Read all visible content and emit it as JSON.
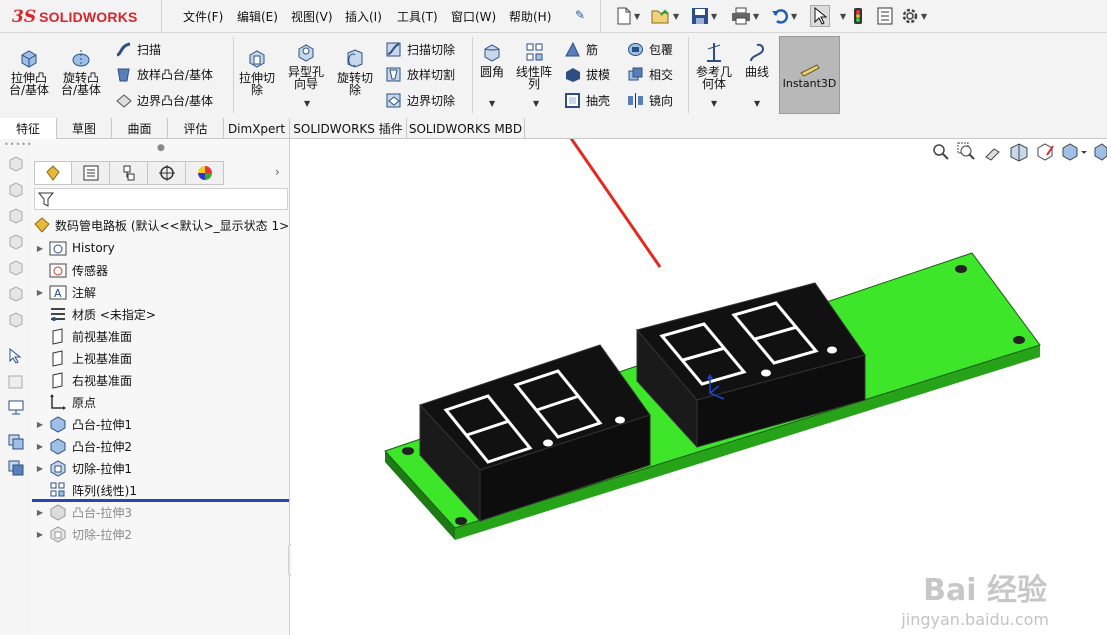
{
  "app": {
    "brand_prefix": "3S",
    "brand_name": "SOLIDWORKS"
  },
  "menu": [
    {
      "label": "文件(F)"
    },
    {
      "label": "编辑(E)"
    },
    {
      "label": "视图(V)"
    },
    {
      "label": "插入(I)"
    },
    {
      "label": "工具(T)"
    },
    {
      "label": "窗口(W)"
    },
    {
      "label": "帮助(H)"
    }
  ],
  "ribbon": {
    "extrude_boss": "拉伸凸\n台/基体",
    "revolve_boss": "旋转凸\n台/基体",
    "sweep": "扫描",
    "loft_boss": "放样凸台/基体",
    "boundary_boss": "边界凸台/基体",
    "extrude_cut": "拉伸切\n除",
    "hole_wizard": "异型孔\n向导",
    "revolve_cut": "旋转切\n除",
    "swept_cut": "扫描切除",
    "lofted_cut": "放样切割",
    "boundary_cut": "边界切除",
    "fillet": "圆角",
    "linear_pattern": "线性阵\n列",
    "rib": "筋",
    "draft": "拔模",
    "shell": "抽壳",
    "wrap": "包覆",
    "intersect": "相交",
    "mirror": "镜向",
    "ref_geometry": "参考几\n何体",
    "curves": "曲线",
    "instant3d": "Instant3D"
  },
  "tabs": [
    {
      "label": "特征",
      "active": true
    },
    {
      "label": "草图"
    },
    {
      "label": "曲面"
    },
    {
      "label": "评估"
    },
    {
      "label": "DimXpert"
    },
    {
      "label": "SOLIDWORKS 插件"
    },
    {
      "label": "SOLIDWORKS MBD"
    }
  ],
  "tree": {
    "root": "数码管电路板 (默认<<默认>_显示状态 1>",
    "items": [
      {
        "label": "History",
        "expandable": true
      },
      {
        "label": "传感器",
        "expandable": false
      },
      {
        "label": "注解",
        "expandable": true
      },
      {
        "label": "材质 <未指定>",
        "expandable": false
      },
      {
        "label": "前视基准面",
        "expandable": false
      },
      {
        "label": "上视基准面",
        "expandable": false
      },
      {
        "label": "右视基准面",
        "expandable": false
      },
      {
        "label": "原点",
        "expandable": false
      },
      {
        "label": "凸台-拉伸1",
        "expandable": true
      },
      {
        "label": "凸台-拉伸2",
        "expandable": true
      },
      {
        "label": "切除-拉伸1",
        "expandable": true
      },
      {
        "label": "阵列(线性)1",
        "expandable": false
      },
      {
        "label": "凸台-拉伸3",
        "expandable": true,
        "suppressed": true
      },
      {
        "label": "切除-拉伸2",
        "expandable": true,
        "suppressed": true
      }
    ]
  },
  "watermark": {
    "brand": "Bai 经验",
    "url": "jingyan.baidu.com"
  },
  "colors": {
    "pcb": "#3ee62a",
    "display": "#111111",
    "arrow": "#e8281e",
    "brand": "#d9252a",
    "rollback": "#2845b8"
  }
}
